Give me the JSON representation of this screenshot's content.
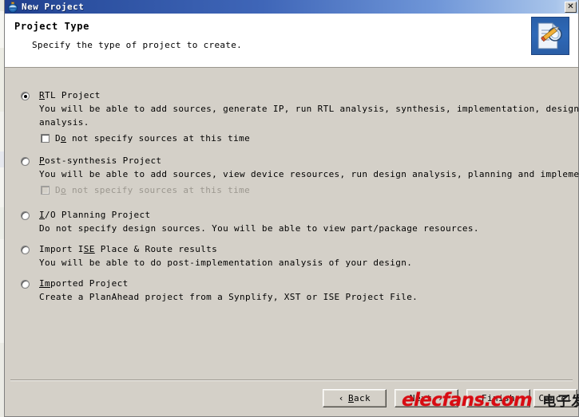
{
  "window": {
    "title": "New Project",
    "icon": "new-project-icon",
    "close_label": "✕"
  },
  "header": {
    "title": "Project Type",
    "subtitle": "Specify the type of project to create.",
    "icon": "project-wizard-icon"
  },
  "options": [
    {
      "id": "rtl-project",
      "label_pre": "",
      "label_accel": "R",
      "label_post": "TL Project",
      "selected": true,
      "desc": [
        "You will be able to add sources, generate IP, run RTL analysis, synthesis, implementation, design planning and",
        "analysis."
      ],
      "checkbox": {
        "id": "do-not-specify-sources-rtl",
        "checked": false,
        "disabled": false,
        "label_pre": "D",
        "label_accel": "o",
        "label_post": " not specify sources at this time"
      }
    },
    {
      "id": "post-synthesis-project",
      "label_pre": "",
      "label_accel": "P",
      "label_post": "ost-synthesis Project",
      "selected": false,
      "desc": [
        "You will be able to add sources, view device resources, run design analysis, planning and implementation."
      ],
      "checkbox": {
        "id": "do-not-specify-sources-post-synthesis",
        "checked": false,
        "disabled": true,
        "label_pre": "D",
        "label_accel": "o",
        "label_post": " not specify sources at this time"
      }
    },
    {
      "id": "io-planning-project",
      "label_pre": "",
      "label_accel": "I",
      "label_post": "/O Planning Project",
      "selected": false,
      "desc": [
        "Do not specify design sources. You will be able to view part/package resources."
      ],
      "checkbox": null
    },
    {
      "id": "import-ise-place-route-results",
      "label_pre": "Import I",
      "label_accel": "SE",
      "label_post": " Place & Route results",
      "selected": false,
      "desc": [
        "You will be able to do post-implementation analysis of your design."
      ],
      "checkbox": null
    },
    {
      "id": "imported-project",
      "label_pre": "",
      "label_accel": "Im",
      "label_post": "ported Project",
      "selected": false,
      "desc": [
        "Create a PlanAhead project from a Synplify, XST or ISE Project File."
      ],
      "checkbox": null
    }
  ],
  "footer": {
    "back_arrow": "‹",
    "back_pre": "",
    "back_accel": "B",
    "back_post": "ack",
    "next_label": "Next ›",
    "finish_label": "Finish",
    "cancel_label": "Cancel"
  },
  "watermark": {
    "brand": "elecfans.com",
    "brand_cn": "电子发烧友"
  },
  "colors": {
    "title_bar_start": "#1f3e8c",
    "title_bar_end": "#c6d9f2",
    "dialog_face": "#d4d0c8",
    "header_bg": "#ffffff",
    "watermark_red": "#d80b12",
    "disabled_text": "#9b978f"
  }
}
